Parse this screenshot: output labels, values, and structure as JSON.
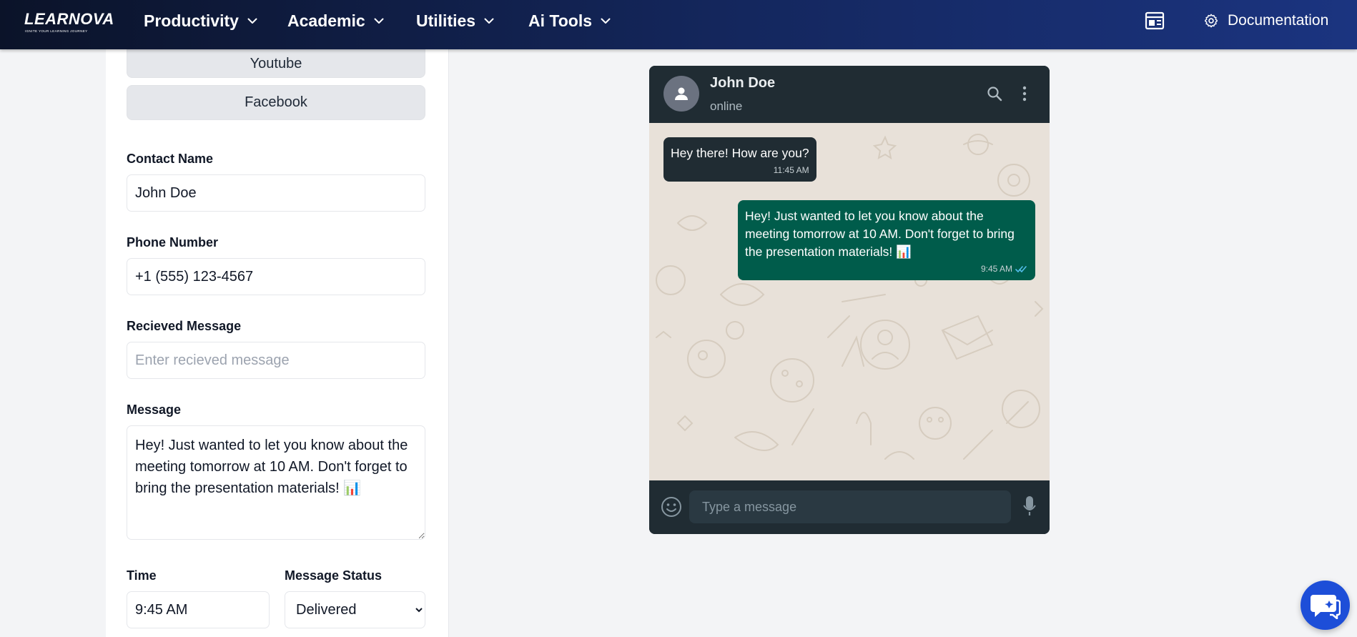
{
  "brand": {
    "logo_text": "LEARNOVA",
    "tagline": "IGNITE YOUR LEARNING JOURNEY"
  },
  "nav": {
    "items": [
      {
        "label": "Productivity"
      },
      {
        "label": "Academic"
      },
      {
        "label": "Utilities"
      },
      {
        "label": "Ai Tools"
      }
    ],
    "documentation_label": "Documentation"
  },
  "form": {
    "platform_buttons": [
      "Youtube",
      "Facebook"
    ],
    "contact_name": {
      "label": "Contact Name",
      "value": "John Doe"
    },
    "phone_number": {
      "label": "Phone Number",
      "value": "+1 (555) 123-4567"
    },
    "received_message": {
      "label": "Recieved Message",
      "placeholder": "Enter recieved message",
      "value": ""
    },
    "message": {
      "label": "Message",
      "value": "Hey! Just wanted to let you know about the meeting tomorrow at 10 AM. Don't forget to bring the presentation materials! 📊"
    },
    "time": {
      "label": "Time",
      "value": "9:45 AM"
    },
    "message_status": {
      "label": "Message Status",
      "value": "Delivered",
      "options": [
        "Delivered"
      ]
    }
  },
  "chat": {
    "contact_name": "John Doe",
    "status": "online",
    "messages": [
      {
        "direction": "incoming",
        "text": "Hey there! How are you?",
        "time": "11:45 AM"
      },
      {
        "direction": "outgoing",
        "text": "Hey! Just wanted to let you know about the meeting tomorrow at 10 AM. Don't forget to bring the presentation materials! 📊",
        "time": "9:45 AM"
      }
    ],
    "input_placeholder": "Type a message"
  },
  "colors": {
    "nav_start": "#0b1329",
    "nav_end": "#1b3480",
    "chat_header": "#202c33",
    "chat_wallpaper": "#e8e1d9",
    "bubble_incoming": "#202c33",
    "bubble_outgoing": "#005c4b",
    "read_tick": "#53bdeb",
    "fab": "#1d4ed8"
  },
  "icons": {
    "nav_chevron": "chevron-down-icon",
    "layout": "layout-icon",
    "documentation": "gear-icon",
    "avatar": "user-icon",
    "search": "search-icon",
    "menu": "more-vertical-icon",
    "emoji": "emoji-icon",
    "mic": "mic-icon",
    "read_receipt": "double-check-icon",
    "help": "chat-help-icon"
  }
}
